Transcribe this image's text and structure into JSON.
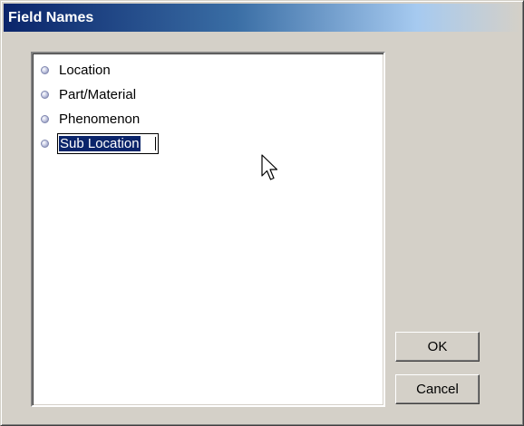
{
  "dialog": {
    "title": "Field Names"
  },
  "list": {
    "items": [
      {
        "label": "Location",
        "selected": false
      },
      {
        "label": "Part/Material",
        "selected": false
      },
      {
        "label": "Phenomenon",
        "selected": false
      },
      {
        "label": "Sub Location",
        "selected": true,
        "editing": true
      }
    ]
  },
  "buttons": {
    "ok_label": "OK",
    "cancel_label": "Cancel"
  },
  "colors": {
    "titlebar_start": "#0a246a",
    "selection": "#0a246a",
    "dialog_face": "#d4d0c8"
  },
  "icons": {
    "list_bullet": "bullet-dot-icon",
    "pointer": "mouse-pointer-icon"
  }
}
